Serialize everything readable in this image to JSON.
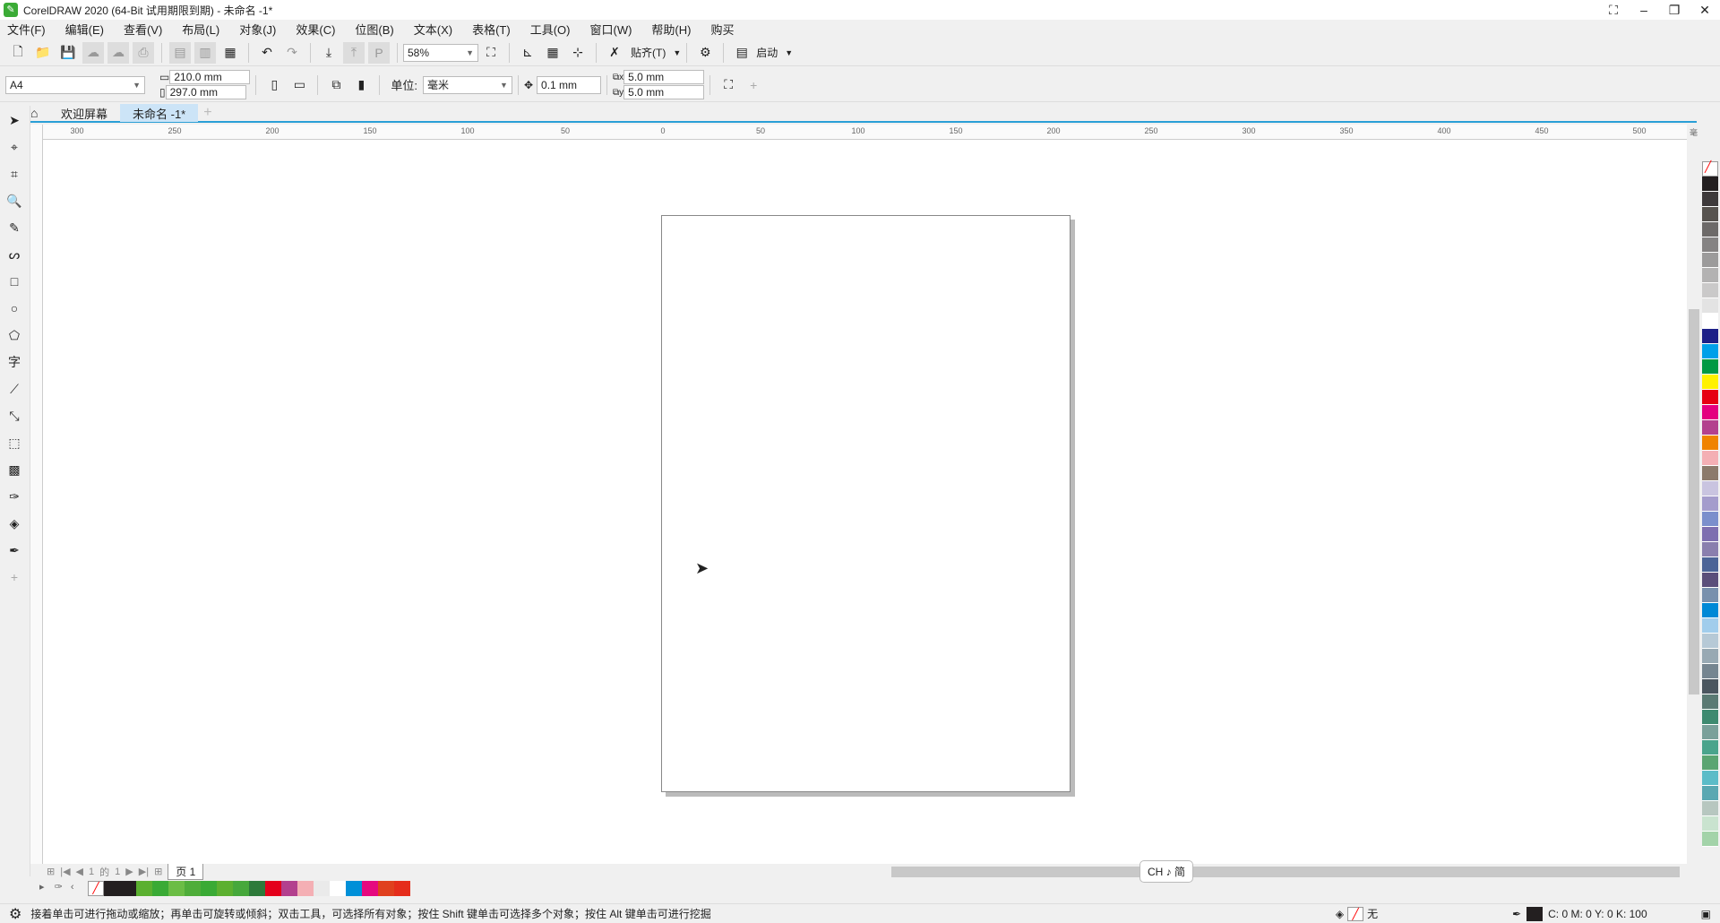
{
  "title": "CorelDRAW 2020 (64-Bit 试用期限到期) - 未命名 -1*",
  "menu": [
    "文件(F)",
    "编辑(E)",
    "查看(V)",
    "布局(L)",
    "对象(J)",
    "效果(C)",
    "位图(B)",
    "文本(X)",
    "表格(T)",
    "工具(O)",
    "窗口(W)",
    "帮助(H)",
    "购买"
  ],
  "toolbar": {
    "zoom": "58%",
    "snap": "贴齐(T)",
    "launch": "启动"
  },
  "propbar": {
    "page_size": "A4",
    "width": "210.0 mm",
    "height": "297.0 mm",
    "unit_label": "单位:",
    "unit": "毫米",
    "nudge": "0.1 mm",
    "dup_x": "5.0 mm",
    "dup_y": "5.0 mm"
  },
  "tabs": {
    "welcome": "欢迎屏幕",
    "doc": "未命名 -1*"
  },
  "ruler": {
    "ticks": [
      "300",
      "250",
      "200",
      "150",
      "100",
      "50",
      "0",
      "50",
      "100",
      "150",
      "200",
      "250",
      "300",
      "350",
      "400",
      "450",
      "500"
    ],
    "unit": "毫米"
  },
  "pagenav": {
    "current": "1",
    "of": "的",
    "total": "1",
    "page_tab": "页 1"
  },
  "ime": "CH ♪ 简",
  "status": {
    "hint": "接着单击可进行拖动或缩放；再单击可旋转或倾斜；双击工具，可选择所有对象；按住 Shift 键单击可选择多个对象；按住 Alt 键单击可进行挖掘",
    "fill": "无",
    "outline": "C: 0 M: 0 Y: 0 K: 100"
  },
  "palette_bottom": [
    "#231f20",
    "#231f20",
    "#5bb030",
    "#3aaa35",
    "#6bbd45",
    "#4fad3a",
    "#3aaa35",
    "#5cb030",
    "#46a83b",
    "#2d7a3a",
    "#e4001b",
    "#b3408e",
    "#f4afb4",
    "#eaeaea",
    "#ffffff",
    "#0090d8",
    "#e5097f",
    "#e0401e",
    "#e52d1b"
  ],
  "palette_right": [
    "#231f20",
    "#3e3a3b",
    "#57534f",
    "#6d6a69",
    "#858383",
    "#9c9b9b",
    "#b3b2b2",
    "#cac9c9",
    "#e3e3e3",
    "#ffffff",
    "#1d2088",
    "#00a0e9",
    "#009944",
    "#fff100",
    "#e60012",
    "#e4007f",
    "#b3408e",
    "#f08300",
    "#f4afb4",
    "#8c7a6b",
    "#c9c4e0",
    "#a49ccc",
    "#7b8fcc",
    "#7e6fb0",
    "#8a7fae",
    "#4c6497",
    "#5a4e7a",
    "#7890ad",
    "#0089d6",
    "#a1cdec",
    "#b6c9d6",
    "#98a9b3",
    "#758590",
    "#4b565f",
    "#5a7a73",
    "#3e8a70",
    "#7aa09a",
    "#4aa48c",
    "#5ba572",
    "#5bbcc8",
    "#5aa8b2",
    "#b7c7c0",
    "#c9e3cf",
    "#a3d3a9"
  ]
}
